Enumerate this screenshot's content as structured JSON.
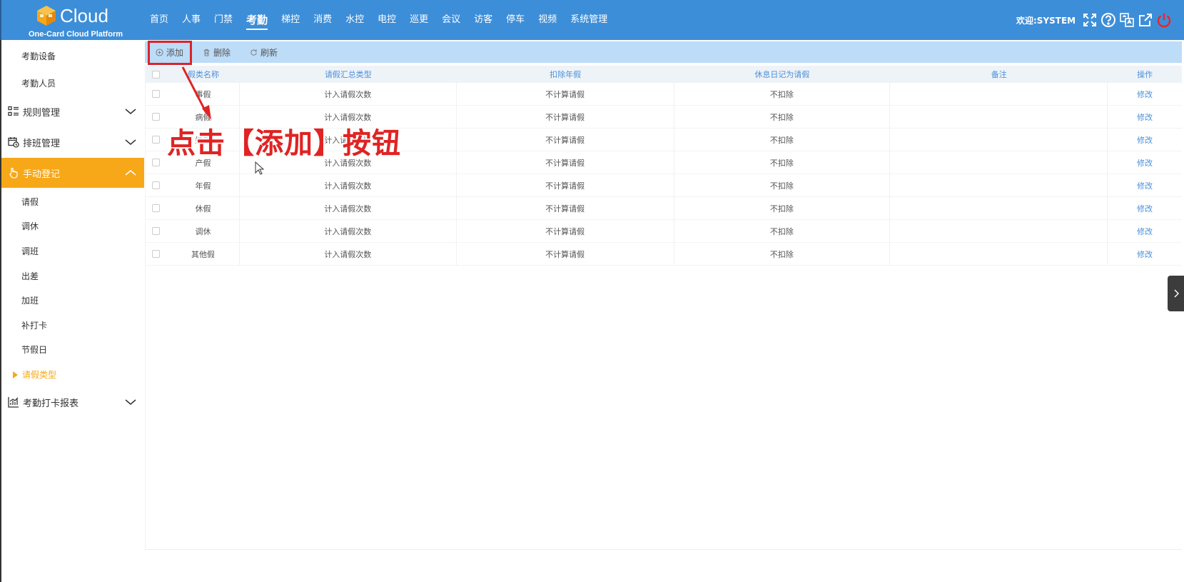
{
  "header": {
    "logo_word": "Cloud",
    "logo_subtitle": "One-Card Cloud Platform",
    "nav": [
      "首页",
      "人事",
      "门禁",
      "考勤",
      "梯控",
      "消费",
      "水控",
      "电控",
      "巡更",
      "会议",
      "访客",
      "停车",
      "视频",
      "系统管理"
    ],
    "active_nav": "考勤",
    "welcome": "欢迎:SYSTEM"
  },
  "sidebar": {
    "top_items": [
      "考勤设备",
      "考勤人员"
    ],
    "groups": {
      "rules": "规则管理",
      "shift": "排班管理",
      "manual": "手动登记",
      "report": "考勤打卡报表"
    },
    "manual_items": [
      "请假",
      "调休",
      "调班",
      "出差",
      "加班",
      "补打卡",
      "节假日"
    ],
    "current_item": "请假类型"
  },
  "toolbar": {
    "add_label": "添加",
    "delete_label": "删除",
    "refresh_label": "刷新"
  },
  "table": {
    "columns": [
      "假类名称",
      "请假汇总类型",
      "扣除年假",
      "休息日记为请假",
      "备注",
      "操作"
    ],
    "rows": [
      {
        "name": "事假",
        "summary": "计入请假次数",
        "deduct": "不计算请假",
        "rest": "不扣除",
        "note": "",
        "action": "修改"
      },
      {
        "name": "病假",
        "summary": "计入请假次数",
        "deduct": "不计算请假",
        "rest": "不扣除",
        "note": "",
        "action": "修改"
      },
      {
        "name": "婚假",
        "summary": "计入请假次数",
        "deduct": "不计算请假",
        "rest": "不扣除",
        "note": "",
        "action": "修改"
      },
      {
        "name": "产假",
        "summary": "计入请假次数",
        "deduct": "不计算请假",
        "rest": "不扣除",
        "note": "",
        "action": "修改"
      },
      {
        "name": "年假",
        "summary": "计入请假次数",
        "deduct": "不计算请假",
        "rest": "不扣除",
        "note": "",
        "action": "修改"
      },
      {
        "name": "休假",
        "summary": "计入请假次数",
        "deduct": "不计算请假",
        "rest": "不扣除",
        "note": "",
        "action": "修改"
      },
      {
        "name": "调休",
        "summary": "计入请假次数",
        "deduct": "不计算请假",
        "rest": "不扣除",
        "note": "",
        "action": "修改"
      },
      {
        "name": "其他假",
        "summary": "计入请假次数",
        "deduct": "不计算请假",
        "rest": "不扣除",
        "note": "",
        "action": "修改"
      }
    ]
  },
  "annotation": {
    "text": "点击【添加】按钮"
  },
  "colors": {
    "header_bg": "#3d8ed8",
    "sidebar_active": "#f7a818",
    "toolbar_bg": "#bcdcf8",
    "annotation_red": "#e02323"
  }
}
